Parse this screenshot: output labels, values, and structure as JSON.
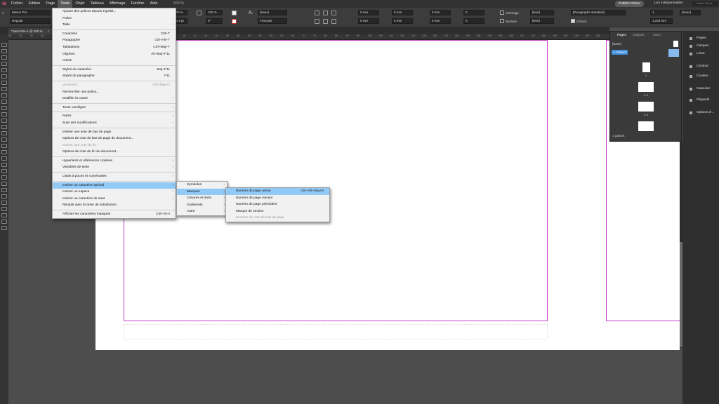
{
  "menubar": {
    "items": [
      "Fichier",
      "Edition",
      "Page",
      "Texte",
      "Objet",
      "Tableau",
      "Affichage",
      "Fenêtre",
      "Aide"
    ],
    "zoom": "200 %",
    "publish": "Publish Online",
    "workspace": "Les indispensables",
    "search_placeholder": "Adobe Stock"
  },
  "control": {
    "font": "Minion Pro",
    "style": "Regular",
    "size1": "12 pt",
    "size2": "14,4 pt",
    "scale": "100 %",
    "scale2": "100 %",
    "track": "0",
    "angle": "0°",
    "charstyle": "[Sans]",
    "lang": "Français",
    "indent1": "0 mm",
    "indent2": "0 mm",
    "indent3": "0 mm",
    "indent4": "0 mm",
    "space1": "0 mm",
    "space2": "0 mm",
    "dropcap": "0",
    "dropcap2": "0",
    "shading": "Ombrage",
    "border": "Bordure",
    "swatch1": "[Noir]",
    "swatch2": "[Noir]",
    "parastyle": "[Paragraphe standard]",
    "hyphen": "Césure",
    "cols": "1",
    "gutter": "4,233 mm",
    "sans": "[Sans]"
  },
  "document_tab": "*Sans titre-1 @ 200 %",
  "ruler": [
    "65",
    "60",
    "55",
    "50",
    "45",
    "40",
    "35",
    "30",
    "25",
    "20",
    "15",
    "10",
    "5",
    "0",
    "5",
    "10",
    "15",
    "20",
    "25",
    "30",
    "35",
    "40",
    "45",
    "50",
    "55",
    "60",
    "65",
    "70",
    "75",
    "80",
    "85",
    "90",
    "95",
    "100",
    "105",
    "110",
    "115",
    "120",
    "125",
    "130",
    "135",
    "140",
    "145",
    "150",
    "155",
    "160",
    "165",
    "170",
    "175",
    "180",
    "185",
    "190",
    "195",
    "200",
    "205"
  ],
  "pages_panel": {
    "tabs": [
      "Pages",
      "Calques",
      "Liens"
    ],
    "none_master": "[Sans]",
    "master": "A-Gabarit",
    "pages": [
      "1",
      "2-3",
      "4-5"
    ],
    "footer": "1 gabarit"
  },
  "right_dock": [
    "Pages",
    "Calques",
    "Liens",
    "Contour",
    "Couleur",
    "Nuancier",
    "Dégradé",
    "Options d'..."
  ],
  "texte_menu": [
    {
      "label": "Ajouter des polices depuis Typekit..."
    },
    {
      "label": "Police",
      "arrow": true
    },
    {
      "label": "Taille",
      "arrow": true
    },
    {
      "sep": true
    },
    {
      "label": "Caractère",
      "sc": "Ctrl+T"
    },
    {
      "label": "Paragraphe",
      "sc": "Ctrl+Alt+T"
    },
    {
      "label": "Tabulations",
      "sc": "Ctrl+Maj+T"
    },
    {
      "label": "Glyphes",
      "sc": "Alt+Maj+F11"
    },
    {
      "label": "Article"
    },
    {
      "sep": true
    },
    {
      "label": "Styles de caractère",
      "sc": "Maj+F11"
    },
    {
      "label": "Styles de paragraphe",
      "sc": "F11"
    },
    {
      "sep": true
    },
    {
      "label": "Vectoriser",
      "sc": "Ctrl+Maj+O",
      "dis": true
    },
    {
      "label": "Rechercher une police..."
    },
    {
      "label": "Modifier la casse",
      "arrow": true
    },
    {
      "sep": true
    },
    {
      "label": "Texte curviligne",
      "arrow": true
    },
    {
      "sep": true
    },
    {
      "label": "Notes",
      "arrow": true
    },
    {
      "label": "Suivi des modifications",
      "arrow": true
    },
    {
      "sep": true
    },
    {
      "label": "Insérer une note de bas de page"
    },
    {
      "label": "Options de note de bas de page du document..."
    },
    {
      "label": "Insérer une note de fin",
      "dis": true
    },
    {
      "label": "Options de note de fin du document..."
    },
    {
      "sep": true
    },
    {
      "label": "Hyperliens et références croisées",
      "arrow": true
    },
    {
      "label": "Variables de texte",
      "arrow": true
    },
    {
      "sep": true
    },
    {
      "label": "Listes à puces et numérotées",
      "arrow": true
    },
    {
      "sep": true
    },
    {
      "label": "Insérer un caractère spécial",
      "arrow": true,
      "hl": true
    },
    {
      "label": "Insérer un espace",
      "arrow": true
    },
    {
      "label": "Insérer un caractère de saut",
      "arrow": true
    },
    {
      "label": "Remplir avec le texte de substitution"
    },
    {
      "sep": true
    },
    {
      "label": "Afficher les caractères masqués",
      "sc": "Ctrl+Alt+I"
    }
  ],
  "special_menu": [
    {
      "label": "Symboles",
      "arrow": true
    },
    {
      "label": "Marques",
      "arrow": true,
      "hl": true
    },
    {
      "label": "Césures et tirets",
      "arrow": true
    },
    {
      "label": "Guillemets",
      "arrow": true
    },
    {
      "label": "Autre",
      "arrow": true
    }
  ],
  "marques_menu": [
    {
      "label": "Numéro de page active",
      "sc": "Ctrl+Alt+Maj+N",
      "hl": true
    },
    {
      "label": "Numéro de page suivant"
    },
    {
      "label": "Numéro de page précédent"
    },
    {
      "label": "Marque de section"
    },
    {
      "label": "Numéro de note de bas de page",
      "dis": true
    }
  ]
}
